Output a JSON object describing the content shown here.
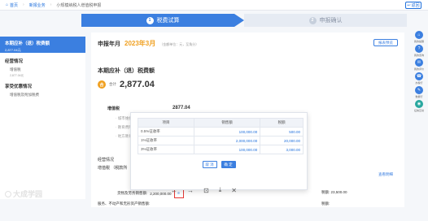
{
  "topbar": {
    "home": "首页",
    "crumb1": "新报业务",
    "crumb2": "小规模纳税人增值税申报",
    "back": "返回"
  },
  "steps": [
    {
      "num": "1",
      "label": "税费试算"
    },
    {
      "num": "2",
      "label": "申报确认"
    }
  ],
  "leftnav": {
    "active_title": "本期应补（退）税费额",
    "active_value": "2,877.04元",
    "sec1": "经营情况",
    "sec1_sub": "增值税",
    "sec1_val": "2,877.04元",
    "sec2": "享受优惠情况",
    "sec2_sub": "增值税及附加税费"
  },
  "main": {
    "period_label": "申报年月",
    "period_value": "2023年3月",
    "period_note": "（金额单位：元，至角分）",
    "preview_btn": "报表预览",
    "section_title": "本期应补（退）税费额",
    "total_badge": "合",
    "total_label": "合计",
    "total_value": "2,877.04",
    "tax_line": "增值税",
    "tax_amount": "2877.04",
    "bg_row1": "· 城市维护",
    "bg_row2": "· 教育费附",
    "bg_row3": "· 地方教育",
    "bg2_row1": "经营情况",
    "bg2_row2": "增值税 （税款所",
    "details_link": "查看明细",
    "sales_label": "货物及劳务销售额:",
    "sales_value": "2,200,000.00",
    "sales_icon": "≡",
    "tax_right_label": "税额:",
    "tax_right_value": "23,500.00",
    "services_label": "服务、不动产和无形资产销售额:",
    "tax_right2": "税额:"
  },
  "modal": {
    "headers": [
      "项目",
      "销售额",
      "税额"
    ],
    "rows": [
      {
        "item": "0.5%征收率",
        "sales": "100,000.00",
        "tax": "500.00"
      },
      {
        "item": "1%征收率",
        "sales": "2,000,000.00",
        "tax": "20,000.00"
      },
      {
        "item": "3%征收率",
        "sales": "100,000.00",
        "tax": "3,000.00"
      }
    ],
    "cancel": "取 消",
    "ok": "确 定"
  },
  "rtool": [
    {
      "icon": "⌂",
      "label": "我的提醒",
      "color": "#3b7fe0"
    },
    {
      "icon": "?",
      "label": "我的咨询",
      "color": "#3b7fe0"
    },
    {
      "icon": "✉",
      "label": "我的评价",
      "color": "#3b7fe0"
    },
    {
      "icon": "☎",
      "label": "办税行",
      "color": "#3b7fe0"
    },
    {
      "icon": "✎",
      "label": "数据行",
      "color": "#3b7fe0"
    },
    {
      "icon": "◉",
      "label": "征纳互动",
      "color": "#2aa8a0"
    }
  ],
  "viewer": [
    "←",
    "→",
    "⊡",
    "⤓",
    "✕"
  ],
  "watermark": "大成学园"
}
